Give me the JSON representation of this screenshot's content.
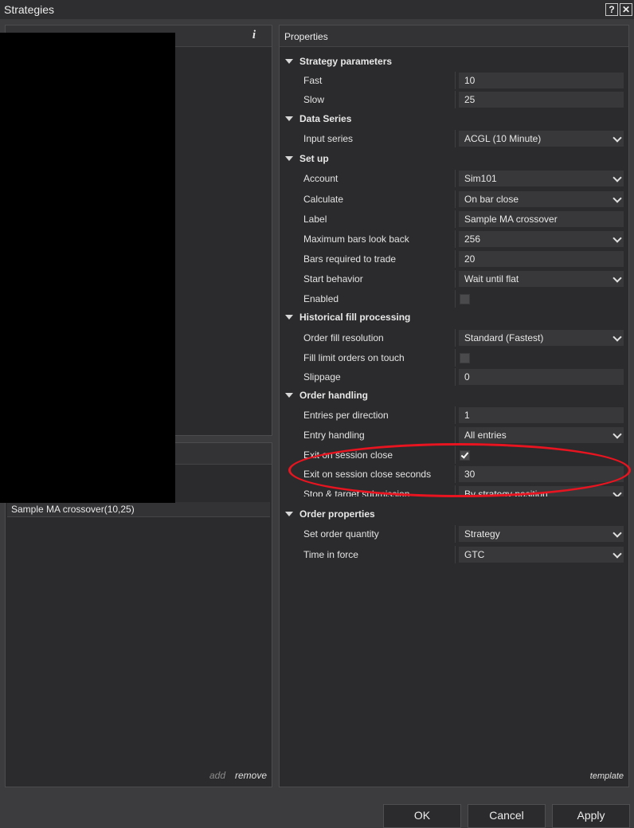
{
  "window": {
    "title": "Strategies",
    "help_label": "?",
    "close_label": "✕"
  },
  "left": {
    "info_label": "i",
    "strategy_instance": "Sample MA crossover(10,25)",
    "add_label": "add",
    "remove_label": "remove"
  },
  "properties": {
    "header": "Properties",
    "template_label": "template",
    "categories": {
      "strategy_parameters": "Strategy parameters",
      "data_series": "Data Series",
      "set_up": "Set up",
      "historical_fill": "Historical fill processing",
      "order_handling": "Order handling",
      "order_properties": "Order properties"
    },
    "rows": {
      "fast": {
        "label": "Fast",
        "value": "10"
      },
      "slow": {
        "label": "Slow",
        "value": "25"
      },
      "input_series": {
        "label": "Input series",
        "value": "ACGL (10 Minute)"
      },
      "account": {
        "label": "Account",
        "value": "Sim101"
      },
      "calculate": {
        "label": "Calculate",
        "value": "On bar close"
      },
      "label": {
        "label": "Label",
        "value": "Sample MA crossover"
      },
      "max_bars": {
        "label": "Maximum bars look back",
        "value": "256"
      },
      "bars_required": {
        "label": "Bars required to trade",
        "value": "20"
      },
      "start_behavior": {
        "label": "Start behavior",
        "value": "Wait until flat"
      },
      "enabled": {
        "label": "Enabled",
        "checked": false
      },
      "order_fill_resolution": {
        "label": "Order fill resolution",
        "value": "Standard (Fastest)"
      },
      "fill_limit": {
        "label": "Fill limit orders on touch",
        "checked": false
      },
      "slippage": {
        "label": "Slippage",
        "value": "0"
      },
      "entries_per_direction": {
        "label": "Entries per direction",
        "value": "1"
      },
      "entry_handling": {
        "label": "Entry handling",
        "value": "All entries"
      },
      "exit_on_session_close": {
        "label": "Exit on session close",
        "checked": true
      },
      "exit_seconds": {
        "label": "Exit on session close seconds",
        "value": "30"
      },
      "stop_target": {
        "label": "Stop & target submission",
        "value": "By strategy position"
      },
      "order_quantity": {
        "label": "Set order quantity",
        "value": "Strategy"
      },
      "time_in_force": {
        "label": "Time in force",
        "value": "GTC"
      }
    }
  },
  "buttons": {
    "ok": "OK",
    "cancel": "Cancel",
    "apply": "Apply"
  },
  "colors": {
    "highlight_ellipse": "#e8141f",
    "background": "#3c3c3e",
    "panel": "#2b2b2d"
  }
}
